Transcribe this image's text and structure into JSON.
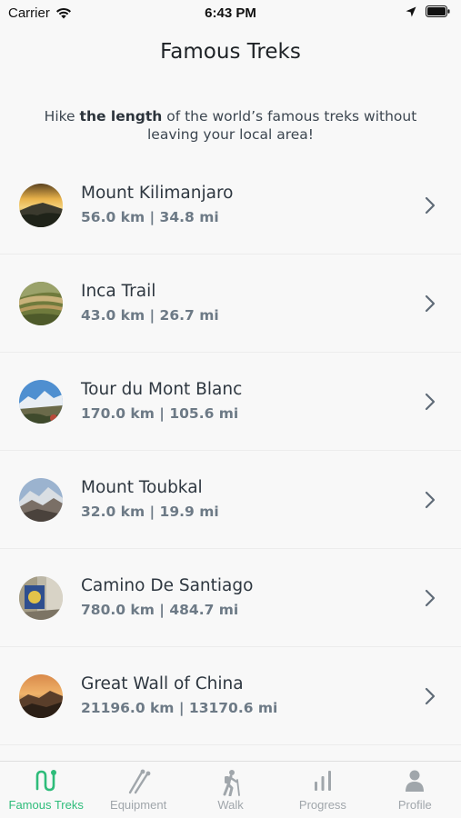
{
  "status_bar": {
    "carrier": "Carrier",
    "time": "6:43 PM"
  },
  "header": {
    "title": "Famous Treks"
  },
  "intro": {
    "prefix": "Hike ",
    "emphasis": "the length",
    "suffix": " of the world’s famous treks without leaving your local area!"
  },
  "treks": [
    {
      "name": "Mount Kilimanjaro",
      "distance": "56.0 km | 34.8 mi"
    },
    {
      "name": "Inca Trail",
      "distance": "43.0 km | 26.7 mi"
    },
    {
      "name": "Tour du Mont Blanc",
      "distance": "170.0 km | 105.6 mi"
    },
    {
      "name": "Mount Toubkal",
      "distance": "32.0 km | 19.9 mi"
    },
    {
      "name": "Camino De Santiago",
      "distance": "780.0 km | 484.7 mi"
    },
    {
      "name": "Great Wall of China",
      "distance": "21196.0 km | 13170.6 mi"
    }
  ],
  "tabs": [
    {
      "label": "Famous Treks",
      "icon": "route-icon",
      "active": true
    },
    {
      "label": "Equipment",
      "icon": "trekking-poles-icon",
      "active": false
    },
    {
      "label": "Walk",
      "icon": "hiker-icon",
      "active": false
    },
    {
      "label": "Progress",
      "icon": "bar-chart-icon",
      "active": false
    },
    {
      "label": "Profile",
      "icon": "person-icon",
      "active": false
    }
  ],
  "colors": {
    "accent": "#2ebc7a",
    "inactive": "#a0a6ab"
  }
}
